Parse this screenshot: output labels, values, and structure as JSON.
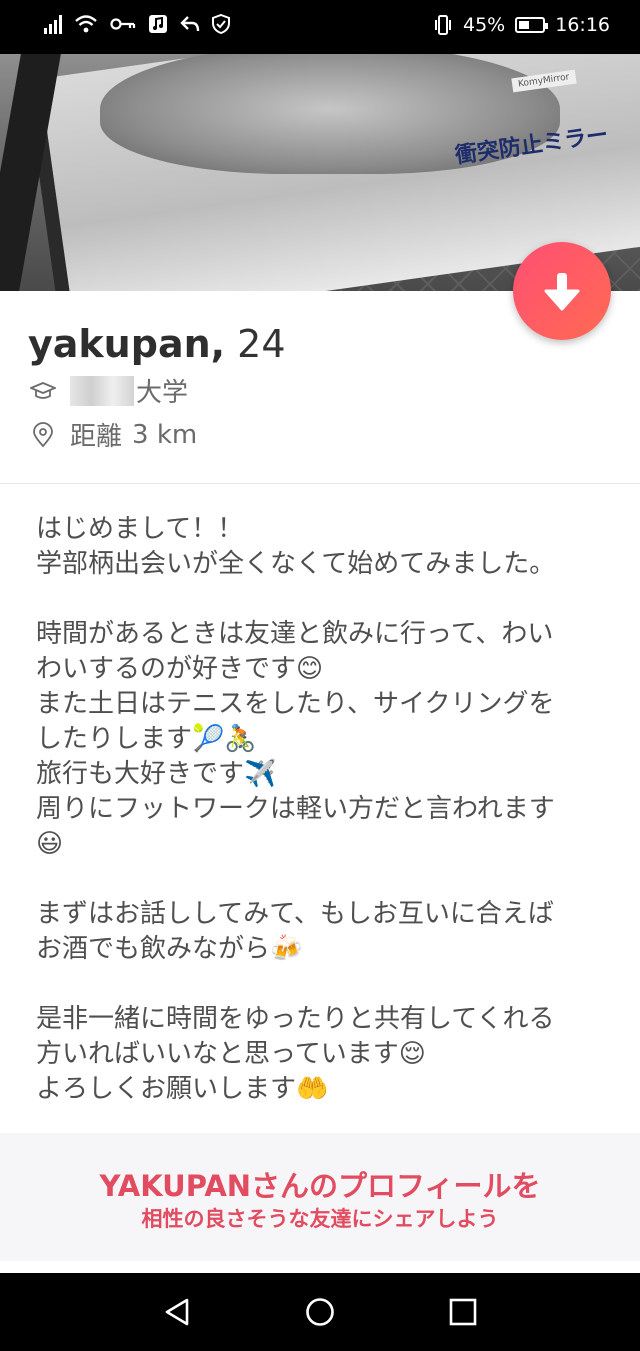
{
  "status_bar": {
    "battery_percent": "45%",
    "time": "16:16",
    "battery_level": 0.45
  },
  "photo": {
    "sign_text": "衝突防止ミラー",
    "brand_text": "KomyMirror"
  },
  "profile": {
    "name": "yakupan,",
    "age": "24",
    "school_suffix": "大学",
    "distance_label": "距離",
    "distance_value": "3 km"
  },
  "bio": {
    "lines": [
      "はじめまして！！",
      "学部柄出会いが全くなくて始めてみました。",
      "",
      "時間があるときは友達と飲みに行って、わい",
      "わいするのが好きです😊",
      "また土日はテニスをしたり、サイクリングを",
      "したりします🎾🚴",
      "旅行も大好きです✈️",
      "周りにフットワークは軽い方だと言われます",
      "😃",
      "",
      "まずはお話ししてみて、もしお互いに合えば",
      "お酒でも飲みながら🍻",
      "",
      "是非一緒に時間をゆったりと共有してくれる",
      "方いればいいなと思っています😌",
      "よろしくお願いします🤲"
    ]
  },
  "share": {
    "title": "YAKUPANさんのプロフィールを",
    "subtitle": "相性の良さそうな友達にシェアしよう"
  },
  "colors": {
    "accent": "#e24c61",
    "fab_start": "#ff4f74",
    "fab_end": "#ff6a52"
  },
  "icons": {
    "fab": "arrow-down-icon",
    "school": "graduation-cap-icon",
    "location": "location-pin-icon",
    "nav_back": "triangle-back-icon",
    "nav_home": "circle-home-icon",
    "nav_recent": "square-recent-icon"
  }
}
